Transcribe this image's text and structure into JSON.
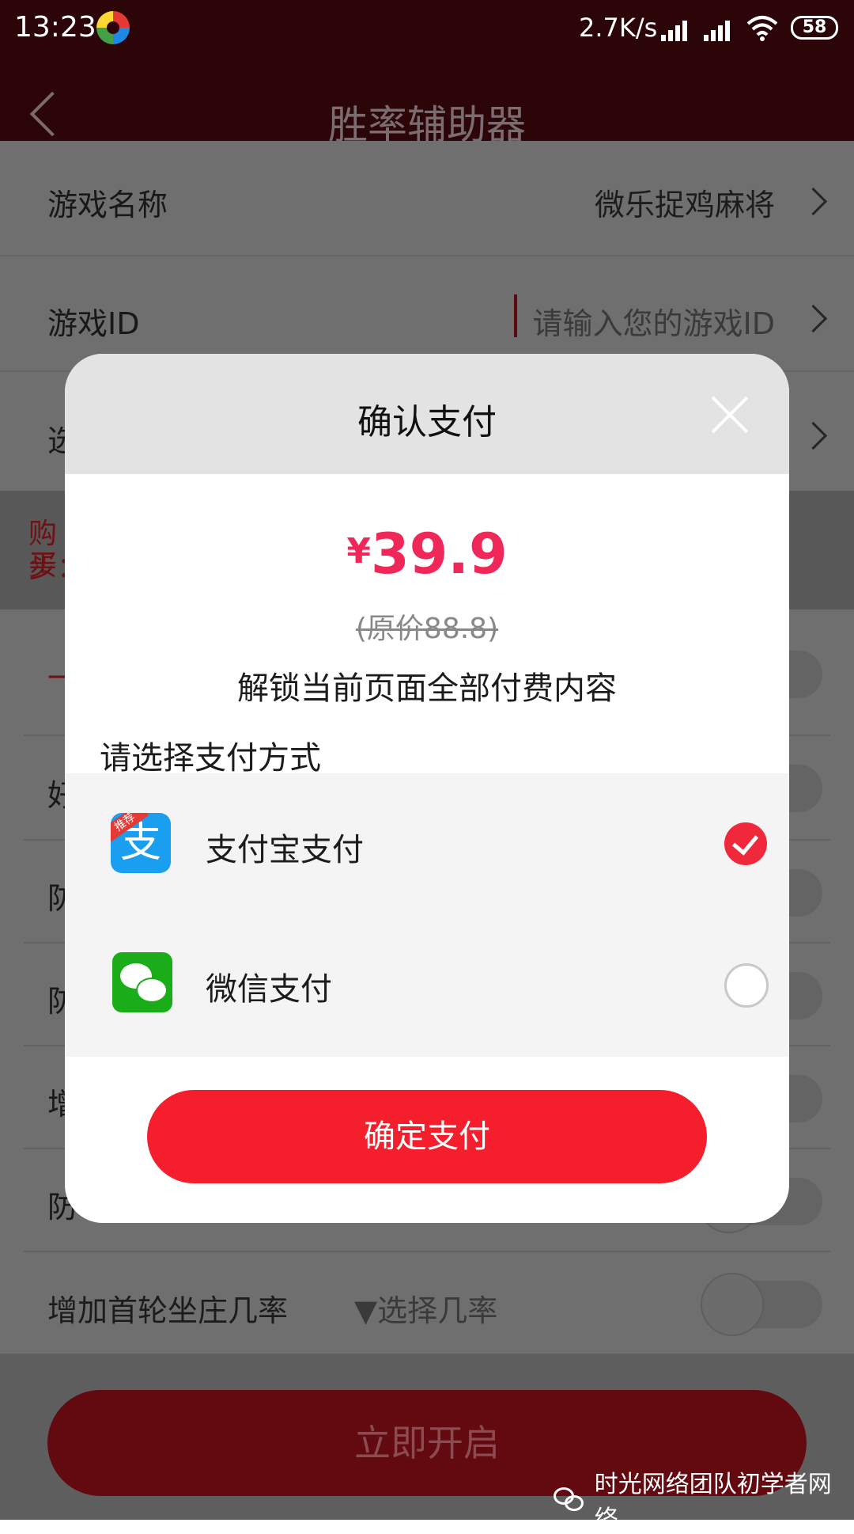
{
  "status_bar": {
    "time": "13:23",
    "net_speed": "2.7K/s",
    "battery": "58"
  },
  "app_bar": {
    "title": "胜率辅助器"
  },
  "page": {
    "game_name_label": "游戏名称",
    "game_name_value": "微乐捉鸡麻将",
    "game_id_label": "游戏ID",
    "game_id_placeholder": "请输入您的游戏ID",
    "hidden_row_label_fragment": "选",
    "notice_fragment_line1": "购买",
    "notice_fragment_line2": "步：",
    "partial_labels": [
      "一",
      "好",
      "防",
      "防",
      "增",
      "防"
    ],
    "last_row_label": "增加首轮坐庄几率",
    "last_row_select": "▼选择几率",
    "start_button": "立即开启"
  },
  "watermark": {
    "text": "时光网络团队初学者网络"
  },
  "modal": {
    "title": "确认支付",
    "currency": "¥",
    "price": "39.9",
    "original_price": "(原价88.8)",
    "unlock_text": "解锁当前页面全部付费内容",
    "select_method": "请选择支付方式",
    "methods": [
      {
        "label": "支付宝支付",
        "icon": "alipay-icon",
        "badge": "推荐",
        "badge_color": "#e53935",
        "icon_color": "#1a9ff0",
        "selected": true
      },
      {
        "label": "微信支付",
        "icon": "wechat-icon",
        "icon_color": "#1aad19",
        "selected": false
      }
    ],
    "confirm_button": "确定支付",
    "accent_color": "#f51e2d",
    "price_color": "#f0285a"
  }
}
